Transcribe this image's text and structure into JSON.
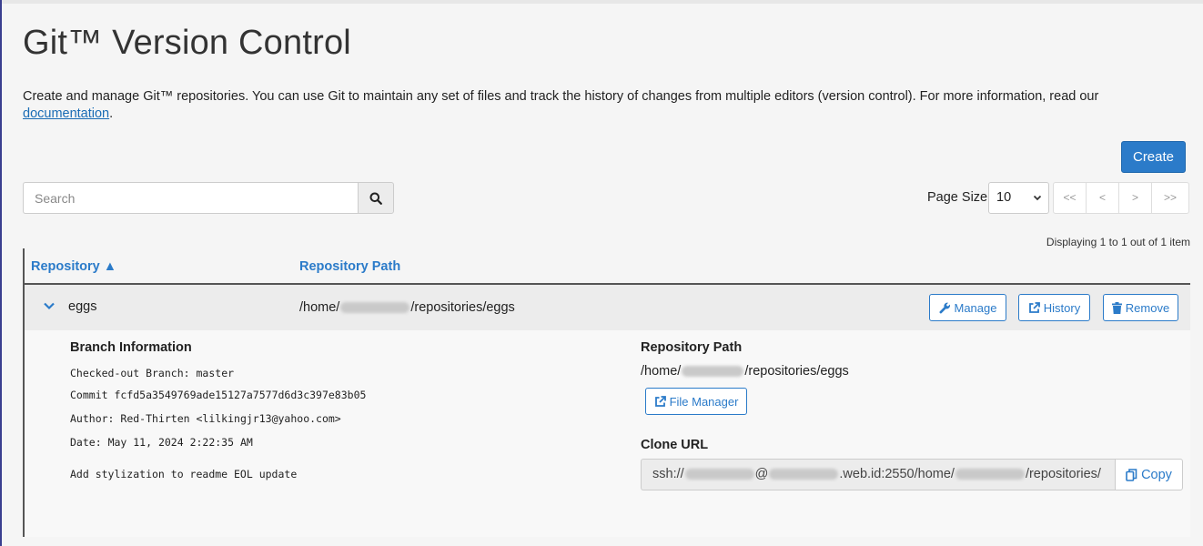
{
  "page": {
    "title": "Git™ Version Control",
    "description": "Create and manage Git™ repositories. You can use Git to maintain any set of files and track the history of changes from multiple editors (version control). For more information, read our",
    "doc_link": "documentation",
    "doc_suffix": "."
  },
  "toolbar": {
    "create_label": "Create",
    "search_placeholder": "Search",
    "page_size_label": "Page Size",
    "page_size_value": "10",
    "pager": [
      "<<",
      "<",
      ">",
      ">>"
    ],
    "displaying": "Displaying 1 to 1 out of 1 item"
  },
  "table": {
    "columns": [
      "Repository ▲",
      "Repository Path"
    ],
    "rows": [
      {
        "name": "eggs",
        "path_prefix": "/home/",
        "path_suffix": "/repositories/eggs",
        "actions": {
          "manage": "Manage",
          "history": "History",
          "remove": "Remove"
        }
      }
    ]
  },
  "detail": {
    "branch_title": "Branch Information",
    "checked_out_label": "Checked-out Branch:",
    "checked_out_value": "master",
    "commit_label": "Commit",
    "commit_value": "fcfd5a3549769ade15127a7577d6d3c397e83b05",
    "author_label": "Author:",
    "author_value": "Red-Thirten <lilkingjr13@yahoo.com>",
    "date_label": "Date:",
    "date_value": "May 11, 2024 2:22:35 AM",
    "message": "Add stylization to readme EOL update",
    "repo_path_title": "Repository Path",
    "repo_path_prefix": "/home/",
    "repo_path_suffix": "/repositories/eggs",
    "file_manager_label": "File Manager",
    "clone_title": "Clone URL",
    "clone_prefix": "ssh://",
    "clone_mid1": "@",
    "clone_mid2": ".web.id:2550/home/",
    "clone_suffix": "/repositories/",
    "copy_label": "Copy"
  },
  "colors": {
    "accent": "#2b7bc9",
    "background": "#f5f5f5",
    "row_bg": "#ececec"
  },
  "icons": {
    "search": "search-icon",
    "chevron": "chevron-down-icon",
    "manage": "wrench-icon",
    "history": "external-link-icon",
    "remove": "trash-icon",
    "file_manager": "external-link-icon",
    "copy": "copy-icon"
  }
}
